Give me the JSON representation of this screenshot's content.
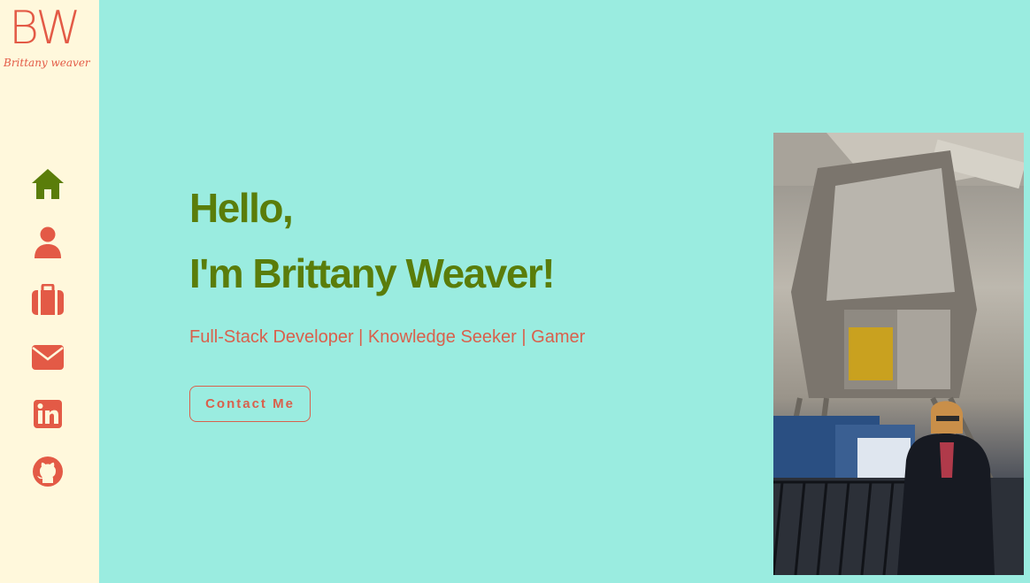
{
  "logo": {
    "monogram": "BW",
    "name": "Brittany weaver"
  },
  "nav": {
    "items": [
      {
        "icon": "home-icon",
        "label": "Home",
        "active": true,
        "color": "#5a7d0a"
      },
      {
        "icon": "user-icon",
        "label": "About",
        "active": false,
        "color": "#e35a46"
      },
      {
        "icon": "briefcase-icon",
        "label": "Portfolio",
        "active": false,
        "color": "#e35a46"
      },
      {
        "icon": "envelope-icon",
        "label": "Contact",
        "active": false,
        "color": "#e35a46"
      },
      {
        "icon": "linkedin-icon",
        "label": "LinkedIn",
        "active": false,
        "color": "#e35a46"
      },
      {
        "icon": "github-icon",
        "label": "GitHub",
        "active": false,
        "color": "#e35a46"
      }
    ]
  },
  "hero": {
    "greeting_line1": "Hello,",
    "greeting_line2": "I'm Brittany Weaver!",
    "tagline": "Full-Stack Developer | Knowledge Seeker | Gamer",
    "cta_label": "Contact Me"
  },
  "colors": {
    "background": "#9aece0",
    "sidebar": "#fff8dc",
    "heading": "#5a7d0a",
    "accent": "#e35a46"
  }
}
